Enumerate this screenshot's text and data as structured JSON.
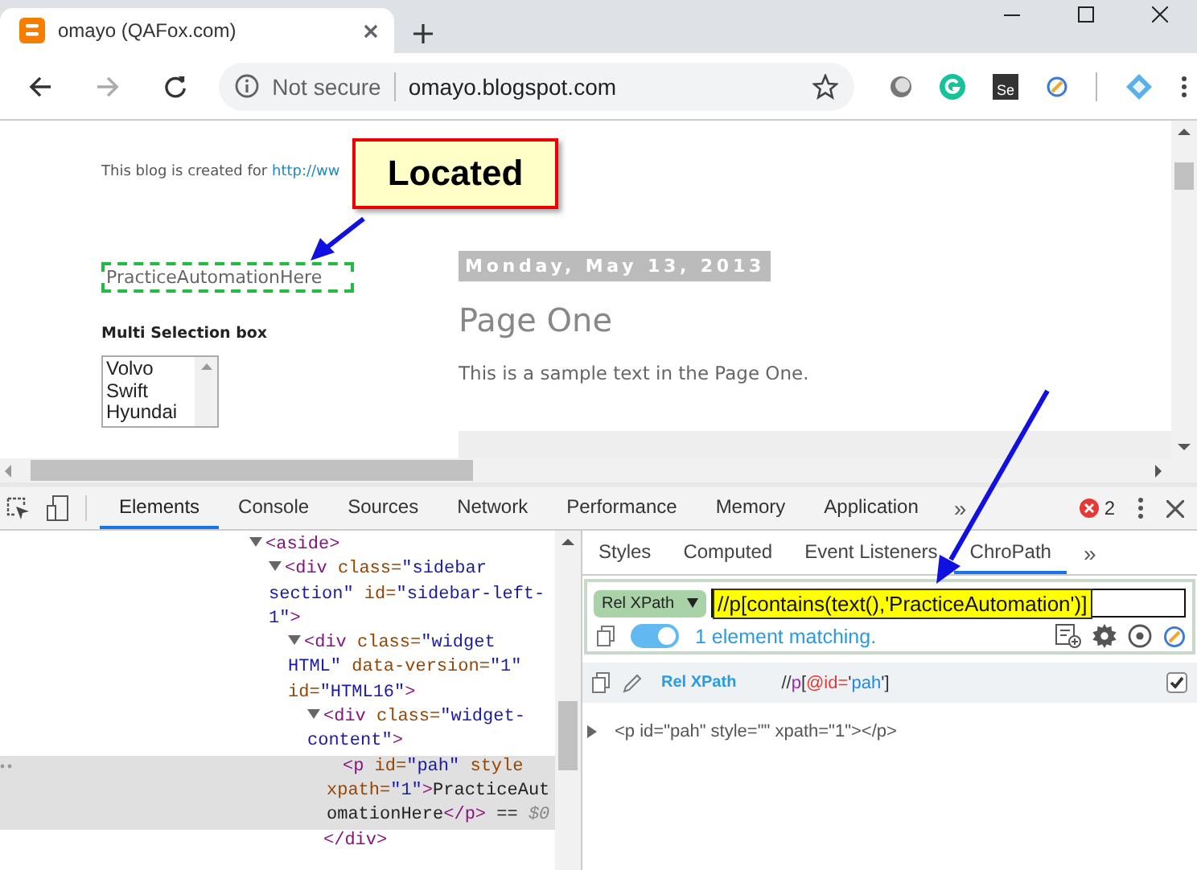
{
  "browser_tab": {
    "title": "omayo (QAFox.com)"
  },
  "address_bar": {
    "security": "Not secure",
    "url": "omayo.blogspot.com"
  },
  "extension_label": "Se",
  "page": {
    "intro": "This blog is created for ",
    "intro_link": "http://ww",
    "matched_text": "PracticeAutomationHere",
    "highlighted": true,
    "multi_select": {
      "label": "Multi Selection box",
      "options": [
        {
          "label": "Volvo",
          "selected": false
        },
        {
          "label": "Swift",
          "selected": false
        },
        {
          "label": "Hyundai",
          "selected": false
        }
      ]
    },
    "post": {
      "date": "Monday, May 13, 2013",
      "title": "Page One",
      "body": "This is a sample text in the Page One."
    }
  },
  "callout": {
    "label": "Located"
  },
  "devtools": {
    "tabs": [
      {
        "label": "Elements",
        "selected": true
      },
      {
        "label": "Console",
        "selected": false
      },
      {
        "label": "Sources",
        "selected": false
      },
      {
        "label": "Network",
        "selected": false
      },
      {
        "label": "Performance",
        "selected": false
      },
      {
        "label": "Memory",
        "selected": false
      },
      {
        "label": "Application",
        "selected": false
      }
    ],
    "overflow": "»",
    "error_count": "2",
    "elements_tree": [
      {
        "selected": false,
        "expanded": true,
        "tokens": [
          {
            "kind": "tag",
            "text": "<aside>"
          }
        ],
        "children": [
          {
            "selected": false,
            "expanded": true,
            "tokens": [
              {
                "kind": "tag",
                "text": "<div"
              },
              {
                "kind": "attr",
                "text": " class="
              },
              {
                "kind": "value",
                "text": "\"sidebar section\""
              },
              {
                "kind": "attr",
                "text": " id="
              },
              {
                "kind": "value",
                "text": "\"sidebar-left-1\""
              },
              {
                "kind": "tag",
                "text": ">"
              }
            ],
            "children": [
              {
                "selected": false,
                "expanded": true,
                "tokens": [
                  {
                    "kind": "tag",
                    "text": "<div"
                  },
                  {
                    "kind": "attr",
                    "text": " class="
                  },
                  {
                    "kind": "value",
                    "text": "\"widget HTML\""
                  },
                  {
                    "kind": "attr",
                    "text": " data-version="
                  },
                  {
                    "kind": "value",
                    "text": "\"1\""
                  },
                  {
                    "kind": "attr",
                    "text": " id="
                  },
                  {
                    "kind": "value",
                    "text": "\"HTML16\""
                  },
                  {
                    "kind": "tag",
                    "text": ">"
                  }
                ],
                "children": [
                  {
                    "selected": false,
                    "expanded": true,
                    "tokens": [
                      {
                        "kind": "tag",
                        "text": "<div"
                      },
                      {
                        "kind": "attr",
                        "text": " class="
                      },
                      {
                        "kind": "value",
                        "text": "\"widget-content\""
                      },
                      {
                        "kind": "tag",
                        "text": ">"
                      }
                    ],
                    "closing": [
                      {
                        "kind": "tag",
                        "text": "</div>"
                      }
                    ],
                    "children": [
                      {
                        "selected": true,
                        "tokens": [
                          {
                            "kind": "tag",
                            "text": "<p"
                          },
                          {
                            "kind": "attr",
                            "text": " id="
                          },
                          {
                            "kind": "value",
                            "text": "\"pah\""
                          },
                          {
                            "kind": "attr",
                            "text": " style"
                          },
                          {
                            "kind": "attr",
                            "text": " xpath="
                          },
                          {
                            "kind": "value",
                            "text": "\"1\""
                          },
                          {
                            "kind": "tag",
                            "text": ">"
                          },
                          {
                            "kind": "text",
                            "text": "PracticeAutomationHere"
                          },
                          {
                            "kind": "tag",
                            "text": "</p>"
                          },
                          {
                            "kind": "text",
                            "text": " == "
                          },
                          {
                            "kind": "hint",
                            "text": "$0"
                          }
                        ]
                      }
                    ]
                  }
                ]
              }
            ]
          }
        ]
      }
    ],
    "side_tabs": [
      {
        "label": "Styles",
        "selected": false
      },
      {
        "label": "Computed",
        "selected": false
      },
      {
        "label": "Event Listeners",
        "selected": false
      },
      {
        "label": "ChroPath",
        "selected": true
      }
    ],
    "side_overflow": "»",
    "chropath": {
      "mode": "Rel XPath",
      "query": "//p[contains(text(),'PracticeAutomation')]",
      "query_highlighted": true,
      "live": true,
      "status": "1 element matching.",
      "result": {
        "label": "Rel XPath",
        "checked": true,
        "tokens": [
          {
            "kind": "punct",
            "text": "//"
          },
          {
            "kind": "tag",
            "text": "p"
          },
          {
            "kind": "punct",
            "text": "["
          },
          {
            "kind": "attr",
            "text": "@id="
          },
          {
            "kind": "punct",
            "text": "'"
          },
          {
            "kind": "value",
            "text": "pah"
          },
          {
            "kind": "punct",
            "text": "']"
          }
        ]
      },
      "match": "<p id=\"pah\" style=\"\" xpath=\"1\"></p>"
    }
  }
}
